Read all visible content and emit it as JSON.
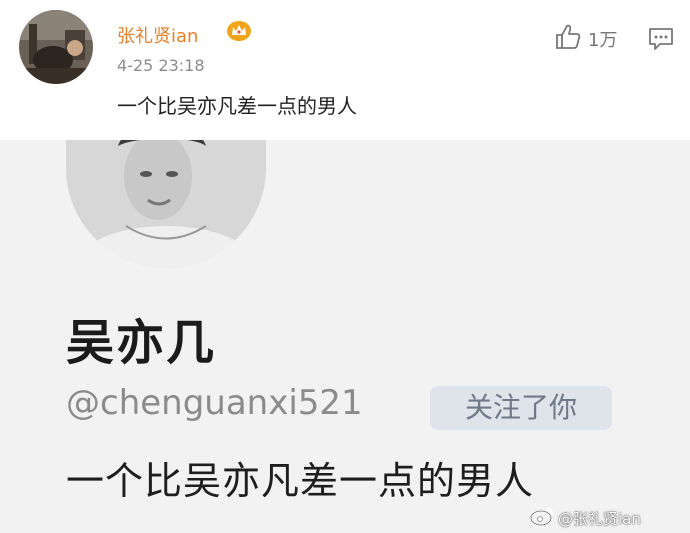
{
  "post": {
    "author": "张礼贤ian",
    "time": "4-25 23:18",
    "text": "一个比吴亦凡差一点的男人",
    "likes": "1万",
    "icons": {
      "badge": "crown-icon",
      "like": "thumbs-up-icon",
      "comment": "comment-icon"
    },
    "colors": {
      "author": "#e8802a",
      "badge": "#f2a51a"
    }
  },
  "embedded_profile": {
    "name": "吴亦几",
    "handle": "@chenguanxi521",
    "follow_badge": "关注了你",
    "bio": "一个比吴亦凡差一点的男人"
  },
  "watermark": {
    "text": "@张礼贤ian",
    "icon": "weibo-logo-icon"
  }
}
